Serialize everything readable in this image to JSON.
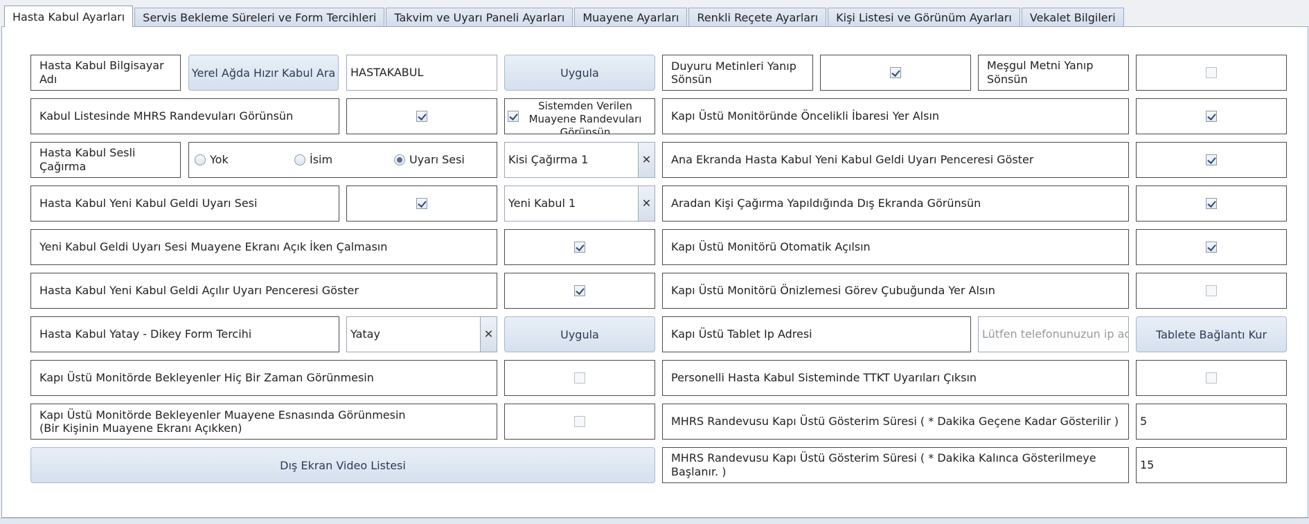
{
  "tabs": [
    {
      "label": "Hasta Kabul Ayarları",
      "active": true
    },
    {
      "label": "Servis Bekleme Süreleri ve Form Tercihleri",
      "active": false
    },
    {
      "label": "Takvim ve Uyarı Paneli Ayarları",
      "active": false
    },
    {
      "label": "Muayene Ayarları",
      "active": false
    },
    {
      "label": "Renkli Reçete Ayarları",
      "active": false
    },
    {
      "label": "Kişi Listesi ve Görünüm Ayarları",
      "active": false
    },
    {
      "label": "Vekalet Bilgileri",
      "active": false
    }
  ],
  "left": {
    "computer_name_label": "Hasta Kabul Bilgisayar Adı",
    "fast_search_button": "Yerel Ağda Hızır Kabul Ara",
    "computer_name_value": "HASTAKABUL",
    "apply_button": "Uygula",
    "mhrs_label": "Kabul Listesinde MHRS Randevuları Görünsün",
    "mhrs_checked": true,
    "system_exams_label": "Sistemden Verilen Muayene Randevuları Görünsün",
    "system_exams_checked": true,
    "voice_call_label": "Hasta Kabul Sesli Çağırma",
    "voice_options": [
      "Yok",
      "İsim",
      "Uyarı Sesi"
    ],
    "voice_selected": "Uyarı Sesi",
    "person_call_value": "Kisi Çağırma 1",
    "new_alert_sound_label": "Hasta Kabul Yeni Kabul Geldi Uyarı Sesi",
    "new_alert_sound_checked": true,
    "new_alert_sound_value": "Yeni Kabul 1",
    "no_play_label": "Yeni Kabul Geldi Uyarı Sesi Muayene Ekranı Açık İken Çalmasın",
    "no_play_checked": true,
    "popup_label": "Hasta Kabul Yeni Kabul Geldi Açılır Uyarı Penceresi Göster",
    "popup_checked": true,
    "form_pref_label": "Hasta Kabul Yatay - Dikey Form Tercihi",
    "form_pref_value": "Yatay",
    "form_apply_button": "Uygula",
    "waiting_never_label": "Kapı Üstü Monitörde Bekleyenler Hiç Bir Zaman Görünmesin",
    "waiting_never_checked": false,
    "waiting_exam_label_1": "Kapı Üstü Monitörde Bekleyenler Muayene Esnasında Görünmesin",
    "waiting_exam_label_2": "(Bir Kişinin Muayene Ekranı Açıkken)",
    "waiting_exam_checked": false,
    "video_list_button": "Dış Ekran Video Listesi"
  },
  "right": {
    "announce_label": "Duyuru Metinleri Yanıp Sönsün",
    "announce_checked": true,
    "busy_label": "Meşgul Metni Yanıp Sönsün",
    "busy_checked": false,
    "priority_label": "Kapı Üstü Monitöründe Öncelikli İbaresi Yer Alsın",
    "priority_checked": true,
    "main_popup_label": "Ana Ekranda Hasta Kabul Yeni Kabul Geldi Uyarı Penceresi Göster",
    "main_popup_checked": true,
    "between_call_label": "Aradan Kişi Çağırma Yapıldığında Dış Ekranda Görünsün",
    "between_call_checked": true,
    "auto_open_label": "Kapı Üstü Monitörü Otomatik Açılsın",
    "auto_open_checked": true,
    "preview_label": "Kapı Üstü Monitörü Önizlemesi Görev Çubuğunda Yer Alsın",
    "preview_checked": false,
    "tablet_ip_label": "Kapı Üstü Tablet Ip Adresi",
    "tablet_ip_placeholder": "Lütfen telefonunuzun ip adre",
    "tablet_connect_button": "Tablete Bağlantı Kur",
    "ttkt_label": "Personelli Hasta Kabul Sisteminde TTKT Uyarıları Çıksın",
    "ttkt_checked": false,
    "mhrs_time_label": "MHRS Randevusu Kapı Üstü Gösterim Süresi ( * Dakika Geçene Kadar Gösterilir )",
    "mhrs_time_value": "5",
    "mhrs_remaining_label": "MHRS Randevusu Kapı Üstü Gösterim Süresi ( * Dakika Kalınca Gösterilmeye Başlanır. )",
    "mhrs_remaining_value": "15"
  },
  "colors": {
    "button_bg": "#dbe5f1",
    "tab_bg": "#d9e2ef",
    "cell_border": "#4a4a4a"
  }
}
